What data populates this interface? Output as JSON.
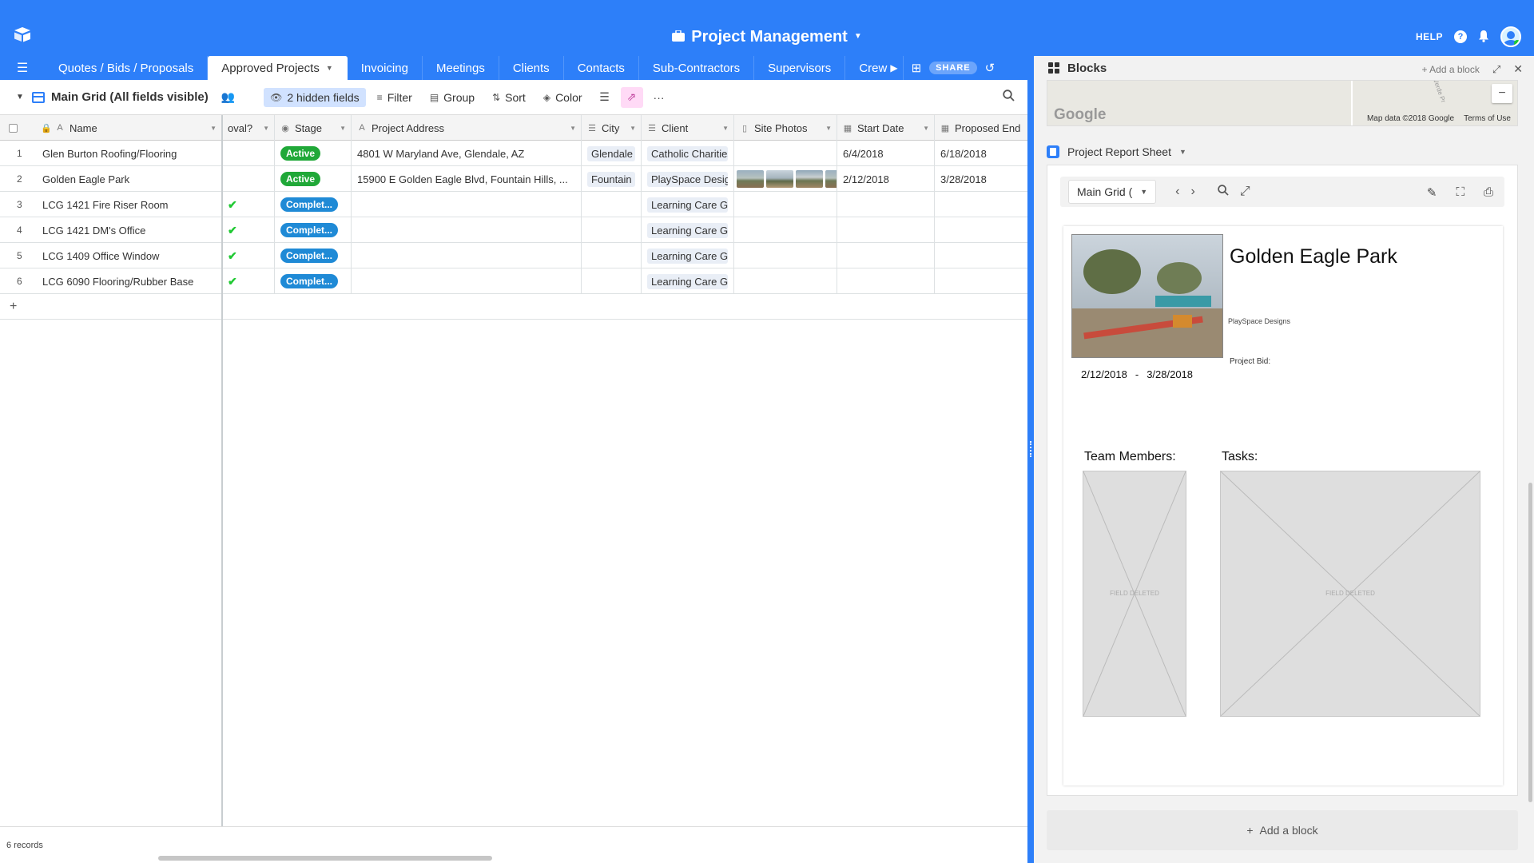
{
  "app": {
    "base_title": "Project Management",
    "help_label": "HELP",
    "help_icon": "?"
  },
  "tabs": [
    {
      "label": "Quotes / Bids / Proposals",
      "active": false
    },
    {
      "label": "Approved Projects",
      "active": true
    },
    {
      "label": "Invoicing",
      "active": false
    },
    {
      "label": "Meetings",
      "active": false
    },
    {
      "label": "Clients",
      "active": false
    },
    {
      "label": "Contacts",
      "active": false
    },
    {
      "label": "Sub-Contractors",
      "active": false
    },
    {
      "label": "Supervisors",
      "active": false
    },
    {
      "label": "Crew",
      "active": false
    }
  ],
  "tabbar_tools": {
    "share_label": "SHARE"
  },
  "view_toolbar": {
    "view_name": "Main Grid (All fields visible)",
    "hidden_fields_label": "2 hidden fields",
    "filter_label": "Filter",
    "group_label": "Group",
    "sort_label": "Sort",
    "color_label": "Color"
  },
  "grid": {
    "columns": {
      "name": "Name",
      "approval": "oval?",
      "stage": "Stage",
      "address": "Project Address",
      "city": "City",
      "client": "Client",
      "photos": "Site Photos",
      "start": "Start Date",
      "end": "Proposed End"
    },
    "rows": [
      {
        "num": "1",
        "name": "Glen Burton Roofing/Flooring",
        "approved": "",
        "stage": "Active",
        "stage_type": "active",
        "address": "4801 W Maryland Ave, Glendale, AZ",
        "city": "Glendale",
        "client": "Catholic Charities",
        "photos": 0,
        "start": "6/4/2018",
        "end": "6/18/2018"
      },
      {
        "num": "2",
        "name": "Golden Eagle Park",
        "approved": "",
        "stage": "Active",
        "stage_type": "active",
        "address": "15900 E Golden Eagle Blvd, Fountain Hills, ...",
        "city": "Fountain H",
        "client": "PlaySpace Designs",
        "photos": 4,
        "start": "2/12/2018",
        "end": "3/28/2018"
      },
      {
        "num": "3",
        "name": "LCG 1421 Fire Riser Room",
        "approved": "✔",
        "stage": "Complet...",
        "stage_type": "complete",
        "address": "",
        "city": "",
        "client": "Learning Care Gr",
        "photos": 0,
        "start": "",
        "end": ""
      },
      {
        "num": "4",
        "name": "LCG 1421 DM's Office",
        "approved": "✔",
        "stage": "Complet...",
        "stage_type": "complete",
        "address": "",
        "city": "",
        "client": "Learning Care Gr",
        "photos": 0,
        "start": "",
        "end": ""
      },
      {
        "num": "5",
        "name": "LCG 1409 Office Window",
        "approved": "✔",
        "stage": "Complet...",
        "stage_type": "complete",
        "address": "",
        "city": "",
        "client": "Learning Care Gr",
        "photos": 0,
        "start": "",
        "end": ""
      },
      {
        "num": "6",
        "name": "LCG 6090 Flooring/Rubber Base",
        "approved": "✔",
        "stage": "Complet...",
        "stage_type": "complete",
        "address": "",
        "city": "",
        "client": "Learning Care Gr",
        "photos": 0,
        "start": "",
        "end": ""
      }
    ],
    "add_row_symbol": "+",
    "records_count": "6 records"
  },
  "blocks": {
    "title": "Blocks",
    "add_block_small": "+ Add a block",
    "map": {
      "google_label": "Google",
      "map_data": "Map data ©2018 Google",
      "terms": "Terms of Use",
      "street_label": "Verde Pr"
    },
    "report": {
      "title": "Project Report Sheet",
      "view_select": "Main Grid (",
      "sheet": {
        "project_name": "Golden Eagle Park",
        "client": "PlaySpace Designs",
        "bid_label": "Project Bid:",
        "start_date": "2/12/2018",
        "date_separator": "-",
        "end_date": "3/28/2018",
        "team_label": "Team Members:",
        "tasks_label": "Tasks:",
        "deleted_label": "FIELD DELETED"
      }
    },
    "add_block_label": "Add a block"
  },
  "colors": {
    "brand_blue": "#2d7ff9",
    "active_green": "#20a838",
    "complete_blue": "#1f8ad6",
    "hidden_fields_bg": "#d1e2ff"
  }
}
